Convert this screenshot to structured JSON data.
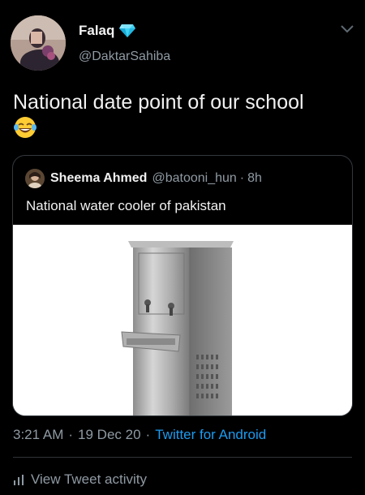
{
  "author": {
    "name": "Falaq",
    "handle": "@DaktarSahiba"
  },
  "tweet": {
    "text": "National date point of our school"
  },
  "quoted_tweet": {
    "name": "Sheema Ahmed",
    "handle": "@batooni_hun",
    "dot": "·",
    "time": "8h",
    "text": "National water cooler of pakistan"
  },
  "meta": {
    "time": "3:21 AM",
    "sep1": "·",
    "date": "19 Dec 20",
    "sep2": "·",
    "source": "Twitter for Android"
  },
  "activity": {
    "label": "View Tweet activity"
  },
  "colors": {
    "background": "#000000",
    "text": "#e7e9ea",
    "muted": "#8f9aa3",
    "link": "#1d9bf0",
    "border": "#33383d"
  },
  "icons": {
    "verified": "verified-diamond-icon",
    "menu": "chevron-down-icon",
    "emoji": "laughing-crying-emoji-icon",
    "activity": "bar-chart-icon"
  }
}
